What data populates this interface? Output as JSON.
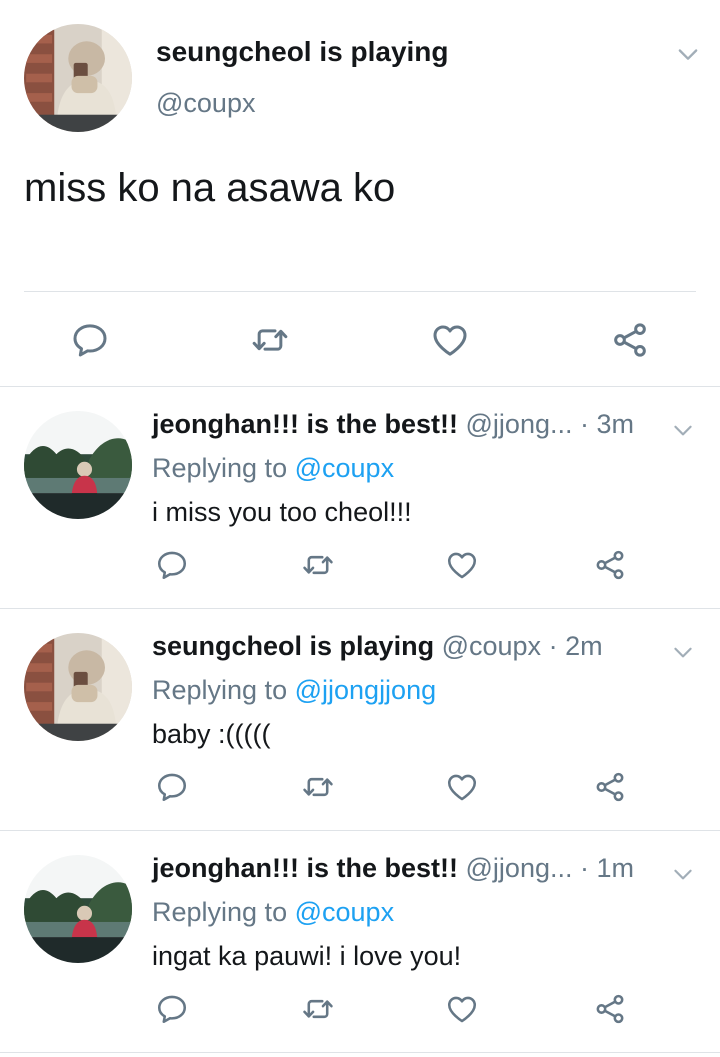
{
  "main_tweet": {
    "author_name": "seungcheol is playing",
    "handle": "@coupx",
    "text": "miss ko na asawa ko"
  },
  "replies": [
    {
      "author_name": "jeonghan!!! is the best!!",
      "handle": "@jjong...",
      "separator": "·",
      "time": "3m",
      "replying_label": "Replying to",
      "replying_to": "@coupx",
      "text": "i miss you too cheol!!!"
    },
    {
      "author_name": "seungcheol is playing",
      "handle": "@coupx",
      "separator": "·",
      "time": "2m",
      "replying_label": "Replying to",
      "replying_to": "@jjongjjong",
      "text": "baby :(((((",
      "avatar": "seungcheol"
    },
    {
      "author_name": "jeonghan!!! is the best!!",
      "handle": "@jjong...",
      "separator": "·",
      "time": "1m",
      "replying_label": "Replying to",
      "replying_to": "@coupx",
      "text": "ingat ka pauwi! i love you!"
    }
  ],
  "icons": {
    "reply": "reply-icon",
    "retweet": "retweet-icon",
    "like": "heart-icon",
    "share": "share-icon",
    "menu": "chevron-down-icon"
  },
  "colors": {
    "text": "#14171a",
    "secondary": "#657786",
    "link": "#1da1f2",
    "icon": "#657786",
    "divider": "#dfe3e7"
  }
}
